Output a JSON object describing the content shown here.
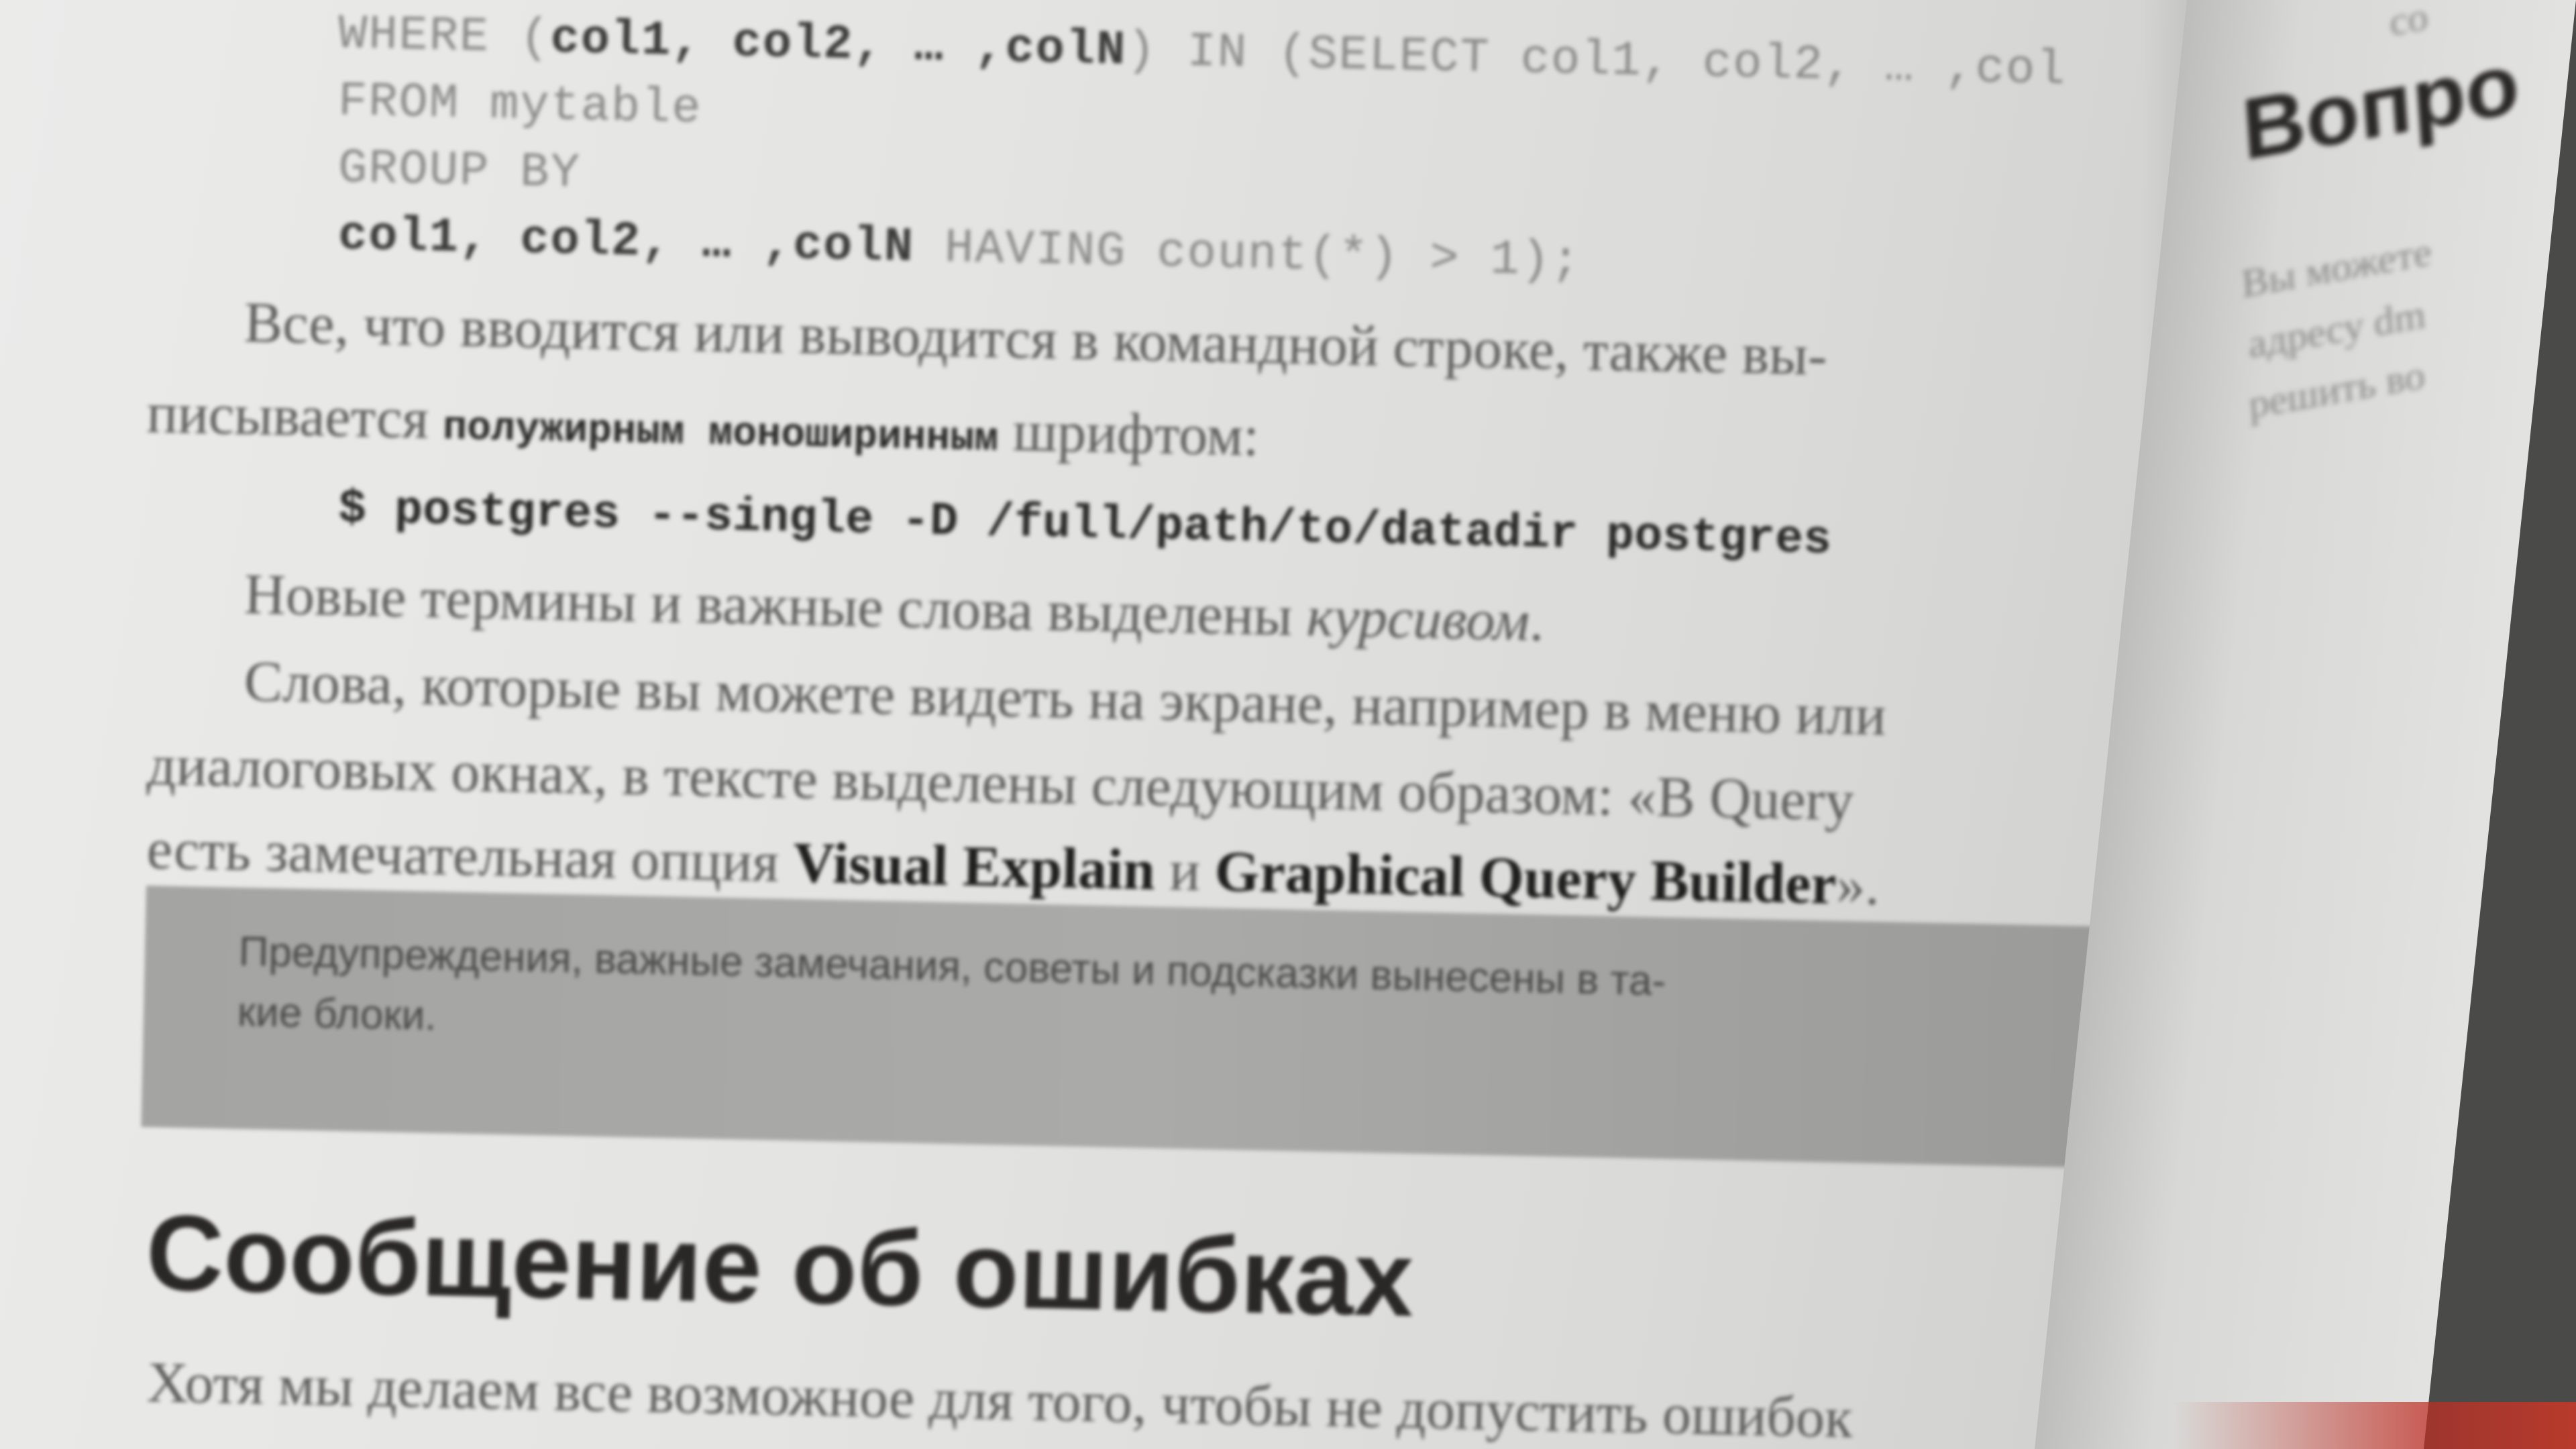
{
  "left_page": {
    "code_lines": [
      {
        "pre": "WHERE (",
        "bold": "col1, col2, … ,colN",
        "post": ") IN (SELECT col1, col2, … ,col"
      },
      {
        "pre": "FROM mytable",
        "bold": "",
        "post": ""
      },
      {
        "pre": "GROUP BY",
        "bold": "",
        "post": ""
      },
      {
        "pre": "",
        "bold": "col1, col2, … ,colN",
        "post": " HAVING count(*) > 1);"
      }
    ],
    "para1_line1": "Все, что вводится или выводится в командной строке, также вы-",
    "para1_line2_pre": "писывается ",
    "para1_line2_bold": "полужирным моноширинным",
    "para1_line2_post": " шрифтом:",
    "command": "$ postgres --single -D /full/path/to/datadir postgres",
    "para2_pre": "Новые термины и важные слова выделены ",
    "para2_italic": "курсивом",
    "para2_post": ".",
    "para3_line1": "Слова, которые вы можете видеть на экране, например в меню или",
    "para3_line2": "диалоговых окнах, в тексте выделены следующим образом: «В Query",
    "para3_line3_pre": "есть замечательная опция ",
    "para3_line3_bold1": "Visual Explain",
    "para3_line3_mid": " и ",
    "para3_line3_bold2": "Graphical Query Builder",
    "para3_line3_post": "».",
    "note_line1": "Предупреждения, важные замечания, советы и подсказки вынесены в та-",
    "note_line2": "кие блоки.",
    "heading": "Сообщение об ошибках",
    "last_line": "Хотя мы делаем все возможное для того, чтобы не допустить ошибок"
  },
  "right_page": {
    "top_fragment": "со",
    "heading": "Вопро",
    "lines": [
      "Вы можете",
      "адресу dm",
      "решить во"
    ]
  }
}
